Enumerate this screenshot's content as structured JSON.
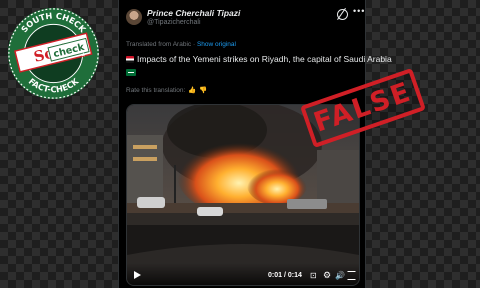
{
  "post": {
    "author_name": "Prince Cherchali Tipazi",
    "author_handle": "@Tipazicherchali",
    "translated_from": "Translated from Arabic · ",
    "show_original": "Show original",
    "text": "Impacts of the Yemeni strikes on Riyadh, the capital of Saudi Arabia",
    "rate_translation": "Rate this translation:",
    "icons": [
      "grok-icon",
      "more-icon",
      "yemen-flag",
      "saudi-flag",
      "thumbs-up-icon",
      "thumbs-down-icon"
    ]
  },
  "video": {
    "time": "0:01 / 0:14",
    "icons": [
      "play-icon",
      "captions-icon",
      "settings-icon",
      "volume-icon",
      "fullscreen-icon"
    ]
  },
  "stamp": {
    "text": "FALSE",
    "color": "#d01f26"
  },
  "seal": {
    "logo_text": "Soch Check",
    "ring_top": "SOUTH CHECK",
    "ring_bottom": "FACT-CHECK",
    "colors": {
      "red": "#d01f26",
      "green": "#1f6e3a"
    }
  }
}
